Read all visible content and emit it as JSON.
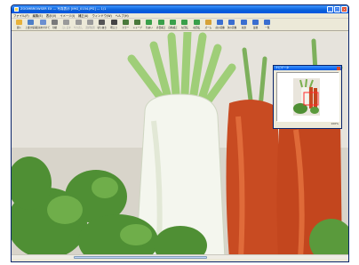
{
  "window": {
    "title": "ZOOMBROWSER EX — 写真表示 [IMG_0154.JPG] — 1/1"
  },
  "menubar": {
    "items": [
      "ファイル(F)",
      "編集(E)",
      "表示(V)",
      "イメージ(I)",
      "補正(A)",
      "ウィンドウ(W)",
      "ヘルプ(H)"
    ]
  },
  "toolbar": {
    "items": [
      {
        "label": "開く",
        "icon": "open-icon",
        "color": "#e8b23a"
      },
      {
        "label": "上書き保存",
        "icon": "save-icon",
        "color": "#4d7fc7"
      },
      {
        "label": "名前を付けて",
        "icon": "save-as-icon",
        "color": "#6b8fd0"
      },
      {
        "label": "印刷",
        "icon": "print-icon",
        "color": "#7a7a7a"
      },
      {
        "label": "元に戻す",
        "icon": "undo-icon",
        "color": "#9a9a9a",
        "disabled": true
      },
      {
        "label": "やり直し",
        "icon": "redo-icon",
        "color": "#9a9a9a",
        "disabled": true
      },
      {
        "label": "選択範囲",
        "icon": "select-icon",
        "color": "#9a9a9a",
        "disabled": true
      },
      {
        "label": "切り抜き",
        "icon": "crop-icon",
        "color": "#555"
      },
      {
        "label": "明るさ",
        "icon": "brightness-icon",
        "color": "#444"
      },
      {
        "label": "カラー",
        "icon": "color-icon",
        "color": "#4a7a3a"
      },
      {
        "label": "シャープ",
        "icon": "sharp-icon",
        "color": "#4a7a3a"
      },
      {
        "label": "色あい",
        "icon": "tone-icon",
        "color": "#3aa04a"
      },
      {
        "label": "赤目補正",
        "icon": "red-eye-icon",
        "color": "#3aa04a"
      },
      {
        "label": "自動補正",
        "icon": "auto-icon",
        "color": "#3aa04a"
      },
      {
        "label": "左回転",
        "icon": "rotate-left-icon",
        "color": "#3aa04a"
      },
      {
        "label": "右回転",
        "icon": "rotate-right-icon",
        "color": "#3aa04a"
      },
      {
        "label": "ズーム",
        "icon": "zoom-icon",
        "color": "#d6a237"
      },
      {
        "label": "前の画像",
        "icon": "prev-icon",
        "color": "#3a6ed0"
      },
      {
        "label": "次の画像",
        "icon": "next-icon",
        "color": "#3a6ed0"
      },
      {
        "label": "先頭",
        "icon": "first-icon",
        "color": "#3a6ed0"
      },
      {
        "label": "最後",
        "icon": "last-icon",
        "color": "#3a6ed0"
      },
      {
        "label": "一覧",
        "icon": "list-icon",
        "color": "#3a6ed0"
      }
    ]
  },
  "navigator": {
    "title": "ナビゲータ",
    "zoom": "100%"
  },
  "colors": {
    "titlebar": "#0054e3",
    "chrome": "#ece9d8"
  }
}
